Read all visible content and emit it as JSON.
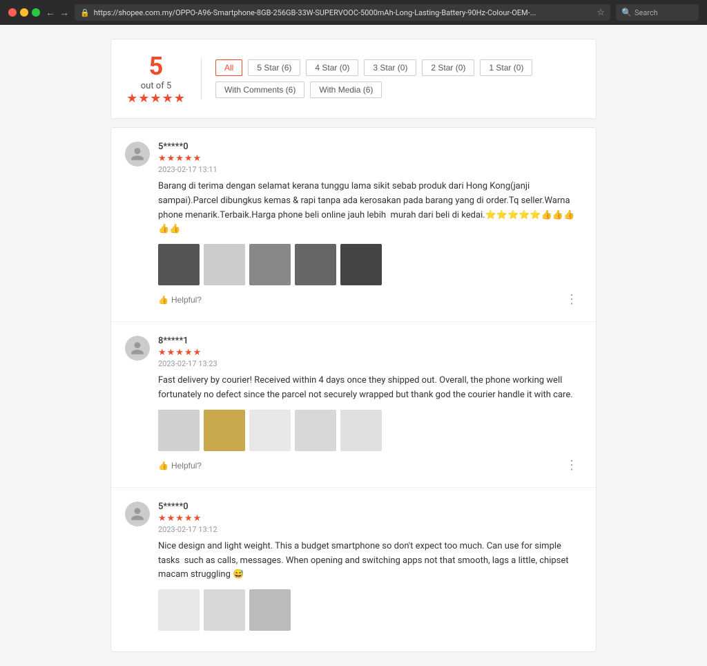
{
  "browser": {
    "url": "https://shopee.com.my/OPPO-A96-Smartphone-8GB-256GB-33W-SUPERVOOC-5000mAh-Long-Lasting-Battery-90Hz-Colour-OEM-...",
    "search_placeholder": "Search"
  },
  "rating": {
    "score": "5",
    "out_of": "out of 5",
    "stars": "★★★★★"
  },
  "filter_buttons": {
    "all": "All",
    "five_star": "5 Star (6)",
    "four_star": "4 Star (0)",
    "three_star": "3 Star (0)",
    "two_star": "2 Star (0)",
    "one_star": "1 Star (0)",
    "with_comments": "With Comments (6)",
    "with_media": "With Media (6)"
  },
  "reviews": [
    {
      "username": "5*****0",
      "stars": "★★★★★",
      "date": "2023-02-17 13:11",
      "text": "Barang di terima dengan selamat kerana tunggu lama sikit sebab produk dari Hong Kong(janji sampai).Parcel dibungkus kemas & rapi tanpa ada kerosakan pada barang yang di order.Tq seller.Warna phone menarik.Terbaik.Harga phone beli online jauh lebih  murah dari beli di kedai.⭐⭐⭐⭐⭐👍👍👍👍👍",
      "helpful": "Helpful?",
      "images": [
        "dark",
        "light",
        "medium",
        "dark2",
        "dark3"
      ],
      "img_colors": [
        "#555",
        "#ccc",
        "#888",
        "#666",
        "#444"
      ]
    },
    {
      "username": "8*****1",
      "stars": "★★★★★",
      "date": "2023-02-17 13:23",
      "text": "Fast delivery by courier! Received within 4 days once they shipped out. Overall, the phone working well fortunately no defect since the parcel not securely wrapped but thank god the courier handle it with care.",
      "helpful": "Helpful?",
      "images": [
        "light2",
        "yellow",
        "white",
        "light3",
        "white2"
      ],
      "img_colors": [
        "#d0d0d0",
        "#c8a84b",
        "#e8e8e8",
        "#d8d8d8",
        "#e0e0e0"
      ]
    },
    {
      "username": "5*****0",
      "stars": "★★★★★",
      "date": "2023-02-17 13:12",
      "text": "Nice design and light weight. This a budget smartphone so don't expect too much. Can use for simple tasks  such as calls, messages. When opening and switching apps not that smooth, lags a little, chipset macam struggling 😅",
      "helpful": "Helpful?",
      "images": [
        "white3",
        "light4",
        "medium2"
      ],
      "img_colors": [
        "#e8e8e8",
        "#d8d8d8",
        "#bbb"
      ]
    }
  ]
}
